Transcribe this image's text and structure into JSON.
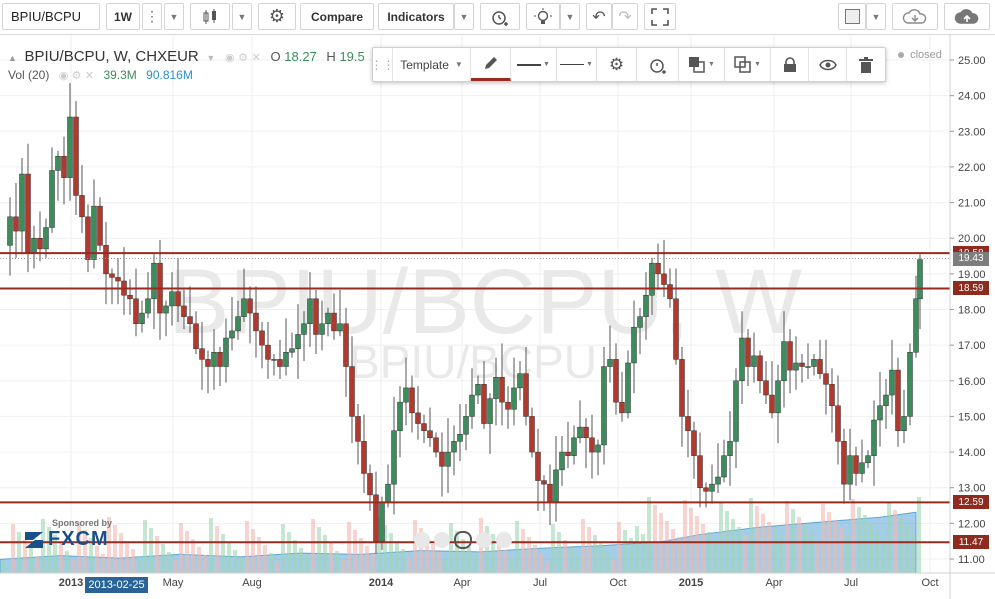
{
  "toolbar": {
    "symbol": "BPIU/BCPU",
    "interval": "1W",
    "compare_label": "Compare",
    "indicators_label": "Indicators",
    "icons": [
      "candles-icon",
      "gear-icon",
      "alarm-add-icon",
      "bulb-icon",
      "undo-icon",
      "redo-icon",
      "fullscreen-icon",
      "square-icon",
      "cloud-download-icon",
      "cloud-upload-icon"
    ]
  },
  "drawing_toolbar": {
    "template_label": "Template",
    "icons": [
      "drag-handle-icon",
      "pencil-icon",
      "line-style-icon",
      "line-width-icon",
      "gear-icon",
      "alarm-add-icon",
      "layers-icon",
      "clone-icon",
      "lock-icon",
      "eye-icon",
      "trash-icon"
    ]
  },
  "legend": {
    "title": "BPIU/BCPU, W, CHXEUR",
    "o_label": "O",
    "o_value": "18.27",
    "h_label": "H",
    "h_value": "19.5",
    "vol_label": "Vol (20)",
    "vol_value": "39.3M",
    "vol_ma_value": "90.816M",
    "status": "closed"
  },
  "watermark": {
    "big": "BPIU/BCPU, W",
    "small": "BPIU/BCPU"
  },
  "sponsor": {
    "label": "Sponsored by",
    "brand": "FXCM"
  },
  "cursor_date": "2013-02-25",
  "colors": {
    "up": "#3d8c5c",
    "down": "#b03a2e",
    "line": "#9b2a1e",
    "volume_area": "#5aa5d6",
    "label_dark": "#8e2b1e",
    "label_gray": "#7d7d7d"
  },
  "chart_data": {
    "type": "candlestick",
    "y_ticks": [
      "25.00",
      "24.00",
      "23.00",
      "22.00",
      "21.00",
      "20.00",
      "19.00",
      "18.00",
      "17.00",
      "16.00",
      "15.00",
      "14.00",
      "13.00",
      "12.00",
      "11.00"
    ],
    "x_ticks": [
      "2013",
      "May",
      "Aug",
      "2014",
      "Apr",
      "Jul",
      "Oct",
      "2015",
      "Apr",
      "Jul",
      "Oct"
    ],
    "ylim": [
      10.6,
      25.4
    ],
    "horizontal_lines": [
      {
        "value": 19.58,
        "label": "19.58"
      },
      {
        "value": 18.59,
        "label": "18.59"
      },
      {
        "value": 12.59,
        "label": "12.59"
      },
      {
        "value": 11.47,
        "label": "11.47"
      }
    ],
    "last_price": {
      "value": 19.43,
      "label": "19.43"
    },
    "close_path": [
      [
        0,
        19.8
      ],
      [
        10,
        20.6
      ],
      [
        16,
        20.2
      ],
      [
        22,
        21.8
      ],
      [
        28,
        19.6
      ],
      [
        34,
        20.0
      ],
      [
        40,
        19.7
      ],
      [
        46,
        20.3
      ],
      [
        52,
        21.9
      ],
      [
        58,
        22.3
      ],
      [
        64,
        21.7
      ],
      [
        70,
        23.4
      ],
      [
        76,
        21.2
      ],
      [
        82,
        20.6
      ],
      [
        88,
        19.4
      ],
      [
        94,
        20.9
      ],
      [
        100,
        19.8
      ],
      [
        106,
        19.0
      ],
      [
        112,
        18.9
      ],
      [
        118,
        18.8
      ],
      [
        124,
        18.4
      ],
      [
        130,
        18.3
      ],
      [
        136,
        17.6
      ],
      [
        142,
        17.9
      ],
      [
        148,
        18.3
      ],
      [
        154,
        19.3
      ],
      [
        160,
        17.9
      ],
      [
        166,
        18.1
      ],
      [
        172,
        18.5
      ],
      [
        178,
        18.1
      ],
      [
        184,
        17.8
      ],
      [
        190,
        17.6
      ],
      [
        196,
        16.9
      ],
      [
        202,
        16.6
      ],
      [
        208,
        16.4
      ],
      [
        214,
        16.8
      ],
      [
        220,
        16.4
      ],
      [
        226,
        17.2
      ],
      [
        232,
        17.4
      ],
      [
        238,
        17.8
      ],
      [
        244,
        18.3
      ],
      [
        250,
        17.9
      ],
      [
        256,
        17.4
      ],
      [
        262,
        17.0
      ],
      [
        268,
        16.6
      ],
      [
        274,
        16.6
      ],
      [
        280,
        16.4
      ],
      [
        286,
        16.8
      ],
      [
        292,
        16.9
      ],
      [
        298,
        17.3
      ],
      [
        304,
        17.6
      ],
      [
        310,
        18.3
      ],
      [
        316,
        17.3
      ],
      [
        322,
        17.6
      ],
      [
        328,
        17.9
      ],
      [
        334,
        17.4
      ],
      [
        340,
        17.6
      ],
      [
        346,
        16.4
      ],
      [
        352,
        15.0
      ],
      [
        358,
        14.3
      ],
      [
        364,
        13.4
      ],
      [
        370,
        12.8
      ],
      [
        376,
        11.5
      ],
      [
        382,
        12.6
      ],
      [
        388,
        13.1
      ],
      [
        394,
        14.6
      ],
      [
        400,
        15.4
      ],
      [
        406,
        15.8
      ],
      [
        412,
        15.1
      ],
      [
        418,
        14.8
      ],
      [
        424,
        14.6
      ],
      [
        430,
        14.4
      ],
      [
        436,
        14.0
      ],
      [
        442,
        13.6
      ],
      [
        448,
        14.0
      ],
      [
        454,
        14.3
      ],
      [
        460,
        14.5
      ],
      [
        466,
        15.0
      ],
      [
        472,
        15.6
      ],
      [
        478,
        15.9
      ],
      [
        484,
        14.8
      ],
      [
        490,
        15.5
      ],
      [
        496,
        16.1
      ],
      [
        502,
        15.4
      ],
      [
        508,
        15.2
      ],
      [
        514,
        15.8
      ],
      [
        520,
        16.2
      ],
      [
        526,
        15.0
      ],
      [
        532,
        14.0
      ],
      [
        538,
        13.2
      ],
      [
        544,
        13.1
      ],
      [
        550,
        12.6
      ],
      [
        556,
        13.5
      ],
      [
        562,
        14.0
      ],
      [
        568,
        13.9
      ],
      [
        574,
        14.4
      ],
      [
        580,
        14.7
      ],
      [
        586,
        14.4
      ],
      [
        592,
        14.0
      ],
      [
        598,
        14.2
      ],
      [
        604,
        16.4
      ],
      [
        610,
        16.6
      ],
      [
        616,
        15.4
      ],
      [
        622,
        15.1
      ],
      [
        628,
        16.5
      ],
      [
        634,
        17.5
      ],
      [
        640,
        17.8
      ],
      [
        646,
        18.4
      ],
      [
        652,
        19.3
      ],
      [
        658,
        19.0
      ],
      [
        664,
        18.7
      ],
      [
        670,
        18.3
      ],
      [
        676,
        16.6
      ],
      [
        682,
        15.0
      ],
      [
        688,
        14.6
      ],
      [
        694,
        13.9
      ],
      [
        700,
        13.0
      ],
      [
        706,
        12.9
      ],
      [
        712,
        13.1
      ],
      [
        718,
        13.3
      ],
      [
        724,
        13.9
      ],
      [
        730,
        14.3
      ],
      [
        736,
        16.0
      ],
      [
        742,
        17.2
      ],
      [
        748,
        16.4
      ],
      [
        754,
        16.7
      ],
      [
        760,
        16.0
      ],
      [
        766,
        15.6
      ],
      [
        772,
        15.1
      ],
      [
        778,
        16.0
      ],
      [
        784,
        17.1
      ],
      [
        790,
        16.3
      ],
      [
        796,
        16.5
      ],
      [
        802,
        16.4
      ],
      [
        808,
        16.4
      ],
      [
        814,
        16.6
      ],
      [
        820,
        16.2
      ],
      [
        826,
        15.9
      ],
      [
        832,
        15.3
      ],
      [
        838,
        14.3
      ],
      [
        844,
        13.1
      ],
      [
        850,
        13.9
      ],
      [
        856,
        13.4
      ],
      [
        862,
        13.7
      ],
      [
        868,
        13.9
      ],
      [
        874,
        14.9
      ],
      [
        880,
        15.3
      ],
      [
        886,
        15.6
      ],
      [
        892,
        16.3
      ],
      [
        898,
        14.6
      ],
      [
        904,
        15.0
      ],
      [
        910,
        16.8
      ],
      [
        916,
        18.3
      ],
      [
        920,
        19.4
      ]
    ],
    "volume_ma_path": [
      [
        0,
        0.22
      ],
      [
        60,
        0.28
      ],
      [
        120,
        0.24
      ],
      [
        180,
        0.3
      ],
      [
        240,
        0.26
      ],
      [
        300,
        0.32
      ],
      [
        360,
        0.3
      ],
      [
        420,
        0.36
      ],
      [
        480,
        0.34
      ],
      [
        540,
        0.4
      ],
      [
        600,
        0.44
      ],
      [
        660,
        0.5
      ],
      [
        700,
        0.62
      ],
      [
        760,
        0.74
      ],
      [
        820,
        0.82
      ],
      [
        880,
        0.9
      ],
      [
        916,
        0.98
      ]
    ]
  }
}
